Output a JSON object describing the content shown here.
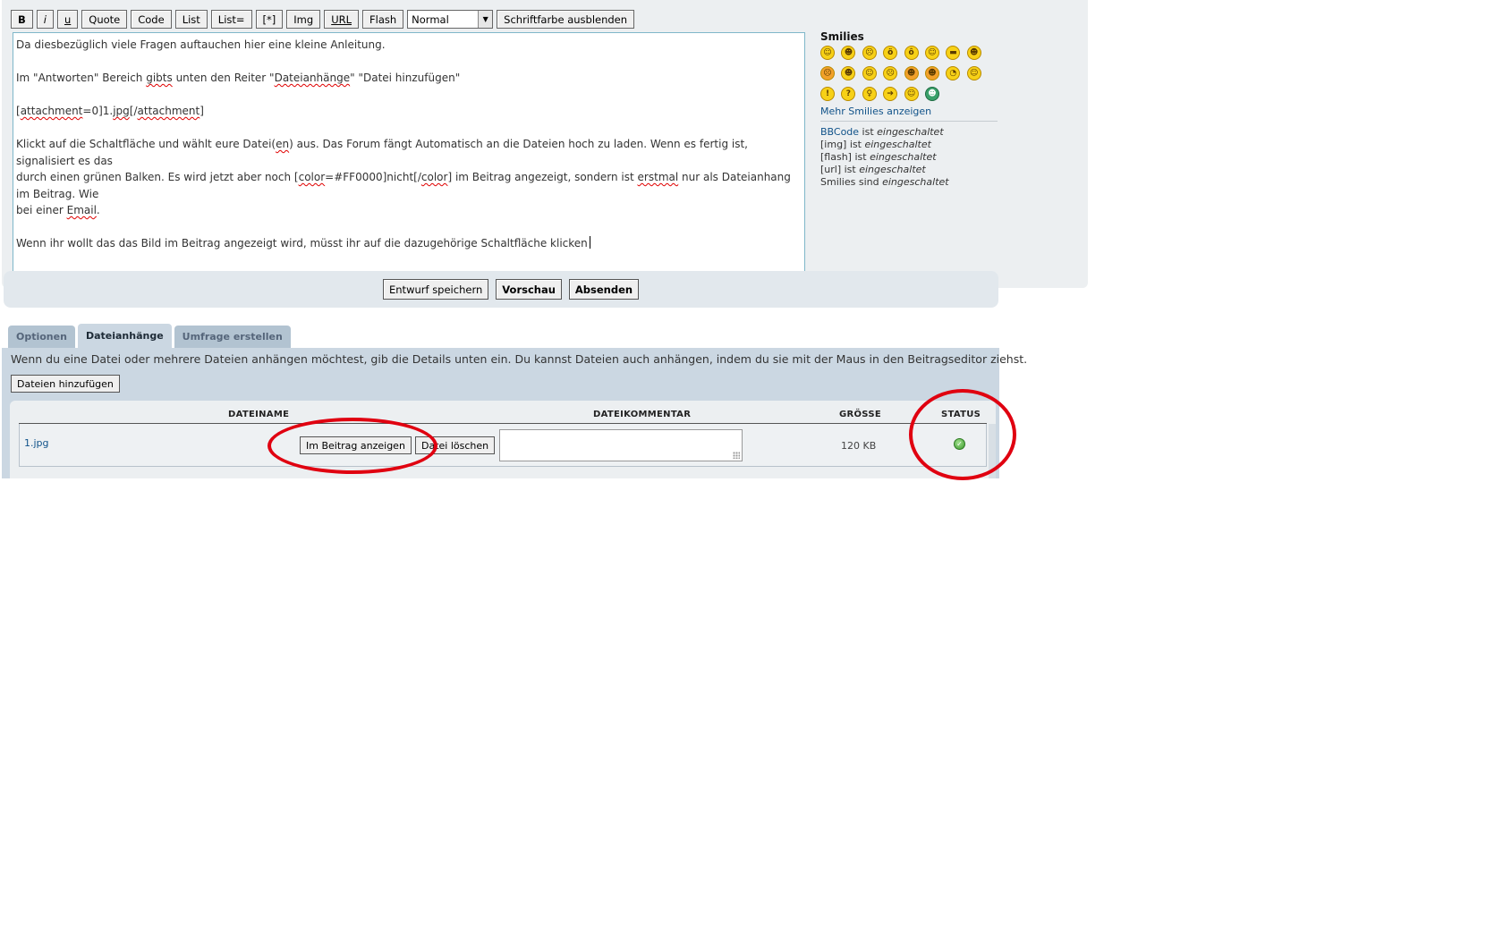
{
  "toolbar": {
    "bold": "B",
    "italic": "i",
    "underline": "u",
    "quote": "Quote",
    "code": "Code",
    "list": "List",
    "list_ordered": "List=",
    "list_item": "[*]",
    "img": "Img",
    "url": "URL",
    "flash": "Flash",
    "font_size_selected": "Normal",
    "color_toggle": "Schriftfarbe ausblenden"
  },
  "message": {
    "line1": "Da diesbezüglich viele Fragen auftauchen hier eine kleine Anleitung.",
    "line2_a": "Im \"Antworten\" Bereich ",
    "line2_sp1": "gibts",
    "line2_b": " unten den Reiter \"",
    "line2_sp2": "Dateianhänge",
    "line2_c": "\" \"Datei hinzufügen\"",
    "line3_a": "[",
    "line3_sp1": "attachment",
    "line3_b": "=0]1.",
    "line3_sp2": "jpg",
    "line3_c": "[/",
    "line3_sp3": "attachment",
    "line3_d": "]",
    "line4_a": "Klickt auf die Schaltfläche und wählt eure Datei(",
    "line4_sp1": "en",
    "line4_b": ") aus. Das Forum fängt Automatisch an die Dateien hoch zu laden. Wenn es fertig ist, signalisiert es das",
    "line5_a": "durch einen grünen Balken. Es wird jetzt aber noch [",
    "line5_sp1": "color",
    "line5_b": "=#FF0000]nicht[/",
    "line5_sp2": "color",
    "line5_c": "] im Beitrag angezeigt, sondern ist ",
    "line5_sp3": "erstmal",
    "line5_d": " nur als Dateianhang im Beitrag. Wie",
    "line6_a": "bei einer ",
    "line6_sp1": "Email",
    "line6_b": ".",
    "line7": "Wenn ihr wollt das das Bild im Beitrag angezeigt wird, müsst ihr auf die dazugehörige Schaltfläche klicken"
  },
  "smilies": {
    "title": "Smilies",
    "icons": [
      "smile-icon",
      "grin-icon",
      "sad-icon",
      "surprised-icon",
      "eek-icon",
      "confused-icon",
      "cool-icon",
      "lol-icon",
      "mad-icon",
      "razz-icon",
      "oops-icon",
      "cry-icon",
      "evil-icon",
      "twisted-icon",
      "roll-icon",
      "wink-icon",
      "exclaim-icon",
      "question-icon",
      "idea-icon",
      "arrow-icon",
      "neutral-icon",
      "mrgreen-icon"
    ],
    "glyphs": [
      "☺",
      "☻",
      "☹",
      "ö",
      "ô",
      "☺",
      "▬",
      "☻",
      "☹",
      "☻",
      "☺",
      "☹",
      "☻",
      "☻",
      "◔",
      "☺",
      "!",
      "?",
      "♀",
      "➔",
      "☺",
      "☻"
    ],
    "more": "Mehr Smilies anzeigen"
  },
  "bbcode_status": {
    "bbcode_label": "BBCode",
    "bbcode_ist": " ist ",
    "bbcode_state": "eingeschaltet",
    "img_label": "[img] ist ",
    "img_state": "eingeschaltet",
    "flash_label": "[flash] ist ",
    "flash_state": "eingeschaltet",
    "url_label": "[url] ist ",
    "url_state": "eingeschaltet",
    "smilies_label": "Smilies sind ",
    "smilies_state": "eingeschaltet"
  },
  "submit": {
    "draft": "Entwurf speichern",
    "preview": "Vorschau",
    "send": "Absenden"
  },
  "tabs": [
    {
      "label": "Optionen"
    },
    {
      "label": "Dateianhänge"
    },
    {
      "label": "Umfrage erstellen"
    }
  ],
  "attachments": {
    "info": "Wenn du eine Datei oder mehrere Dateien anhängen möchtest, gib die Details unten ein. Du kannst Dateien auch anhängen, indem du sie mit der Maus in den Beitragseditor ziehst.",
    "add_button": "Dateien hinzufügen",
    "columns": {
      "name": "DATEINAME",
      "comment": "DATEIKOMMENTAR",
      "size": "GRÖSSE",
      "status": "STATUS"
    },
    "row": {
      "name": "1.jpg",
      "show_button": "Im Beitrag anzeigen",
      "delete_button": "Datei löschen",
      "size": "120 KB",
      "status_icon": "check-icon"
    }
  },
  "colors": {
    "annotation": "#e00010",
    "panel": "#eceff1",
    "tab_active": "#cbd7e2",
    "link": "#105289"
  }
}
